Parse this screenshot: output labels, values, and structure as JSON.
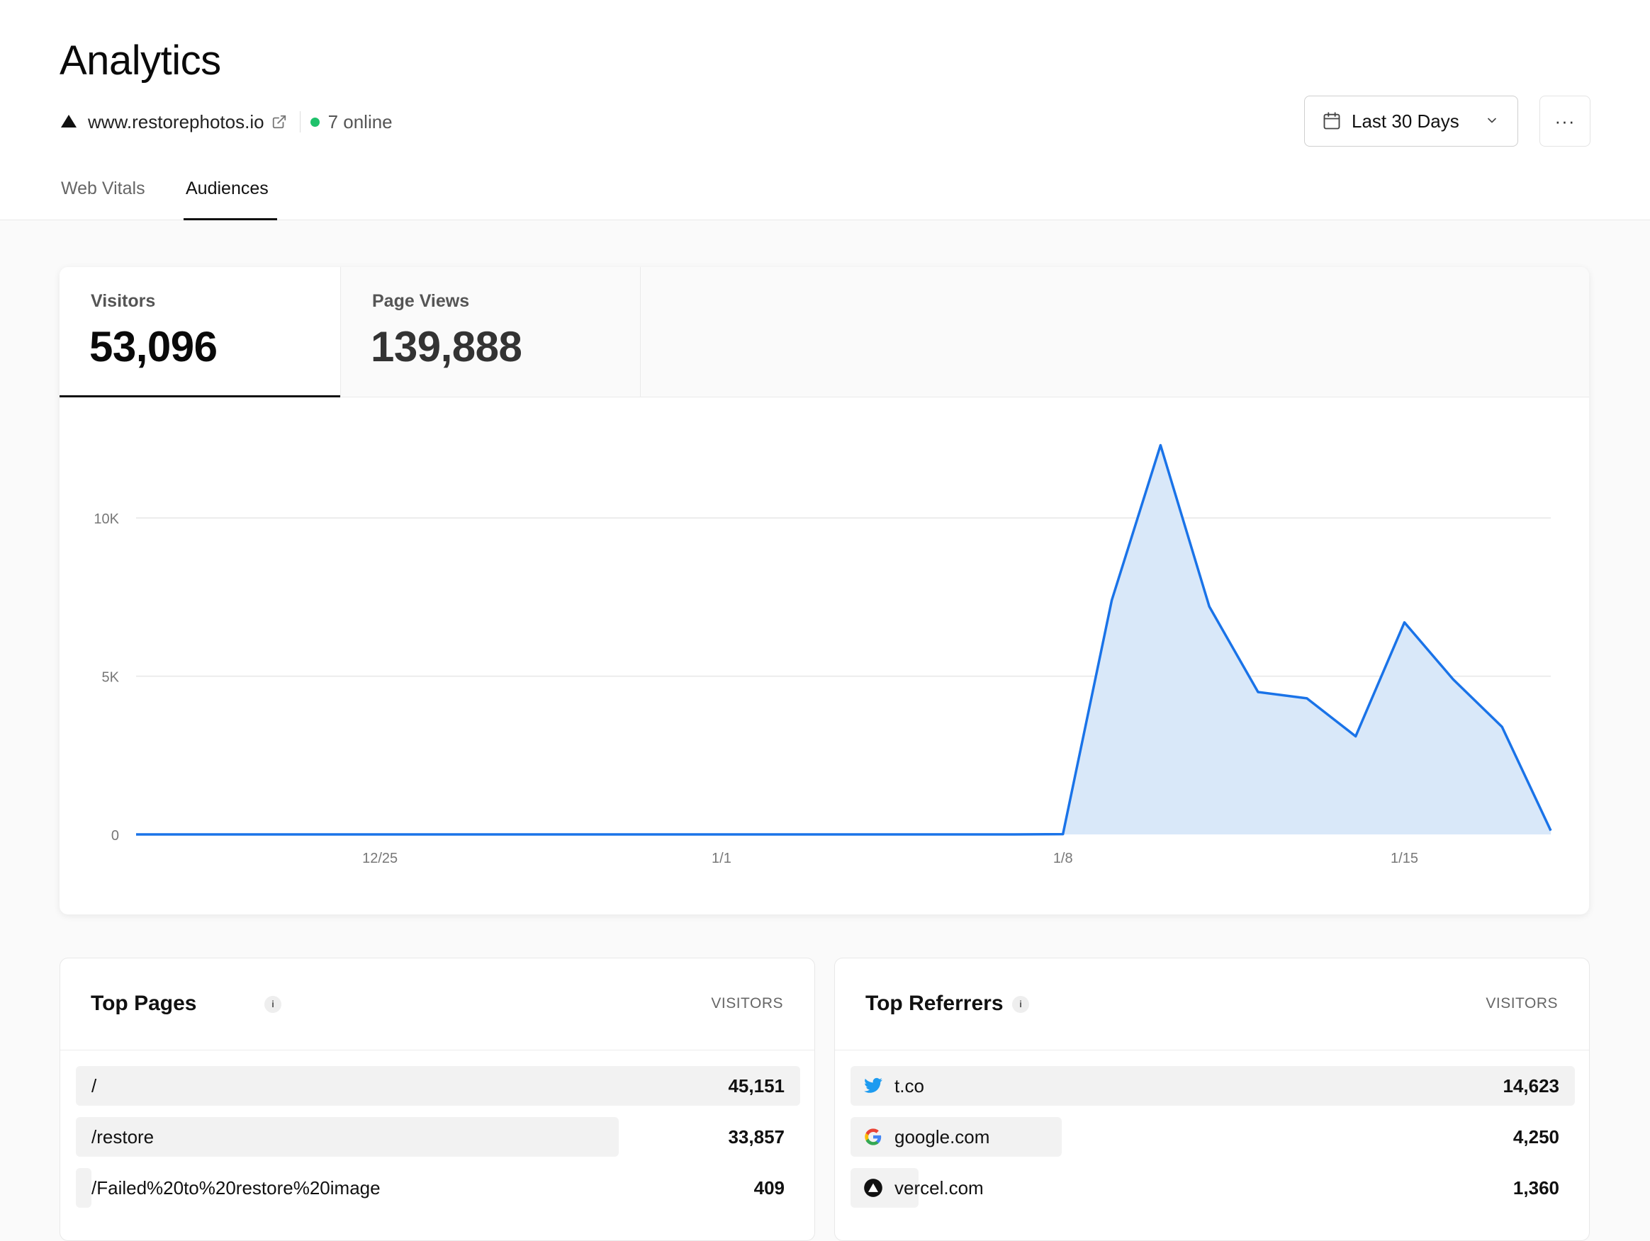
{
  "header": {
    "title": "Analytics",
    "site": "www.restorephotos.io",
    "online": "7 online",
    "date_range": "Last 30 Days",
    "more": "···"
  },
  "tabs": [
    {
      "label": "Web Vitals",
      "active": false
    },
    {
      "label": "Audiences",
      "active": true
    }
  ],
  "metrics": {
    "visitors": {
      "label": "Visitors",
      "value": "53,096",
      "active": true
    },
    "page_views": {
      "label": "Page Views",
      "value": "139,888",
      "active": false
    }
  },
  "colors": {
    "accent_line": "#1a73e8",
    "accent_fill": "#d9e8f9",
    "online": "#1fc16b"
  },
  "chart_data": {
    "type": "area",
    "title": "",
    "xlabel": "",
    "ylabel": "",
    "ylim": [
      0,
      12400
    ],
    "yticks": [
      0,
      5000,
      10000
    ],
    "ytick_labels": [
      "0",
      "5K",
      "10K"
    ],
    "xticks": [
      "12/25",
      "1/1",
      "1/8",
      "1/15"
    ],
    "x": [
      "12/20",
      "12/21",
      "12/22",
      "12/23",
      "12/24",
      "12/25",
      "12/26",
      "12/27",
      "12/28",
      "12/29",
      "12/30",
      "12/31",
      "1/1",
      "1/2",
      "1/3",
      "1/4",
      "1/5",
      "1/6",
      "1/7",
      "1/8",
      "1/9",
      "1/10",
      "1/11",
      "1/12",
      "1/13",
      "1/14",
      "1/15",
      "1/16",
      "1/17",
      "1/18"
    ],
    "series": [
      {
        "values": [
          0,
          0,
          0,
          0,
          0,
          0,
          0,
          0,
          0,
          0,
          0,
          0,
          0,
          0,
          0,
          0,
          0,
          0,
          0,
          10,
          7400,
          12300,
          7200,
          4500,
          4300,
          3100,
          6700,
          4900,
          3400,
          120
        ]
      }
    ],
    "grid": true
  },
  "top_pages": {
    "title": "Top Pages",
    "info": "i",
    "column": "VISITORS",
    "rows": [
      {
        "label": "/",
        "value": "45,151",
        "share": 1.0
      },
      {
        "label": "/restore",
        "value": "33,857",
        "share": 0.75
      },
      {
        "label": "/Failed%20to%20restore%20image",
        "value": "409",
        "share": 0.02
      }
    ]
  },
  "top_referrers": {
    "title": "Top Referrers",
    "info": "i",
    "column": "VISITORS",
    "rows": [
      {
        "label": "t.co",
        "value": "14,623",
        "share": 1.0,
        "icon": "twitter-icon"
      },
      {
        "label": "google.com",
        "value": "4,250",
        "share": 0.29,
        "icon": "google-icon"
      },
      {
        "label": "vercel.com",
        "value": "1,360",
        "share": 0.093,
        "icon": "vercel-icon"
      }
    ]
  }
}
